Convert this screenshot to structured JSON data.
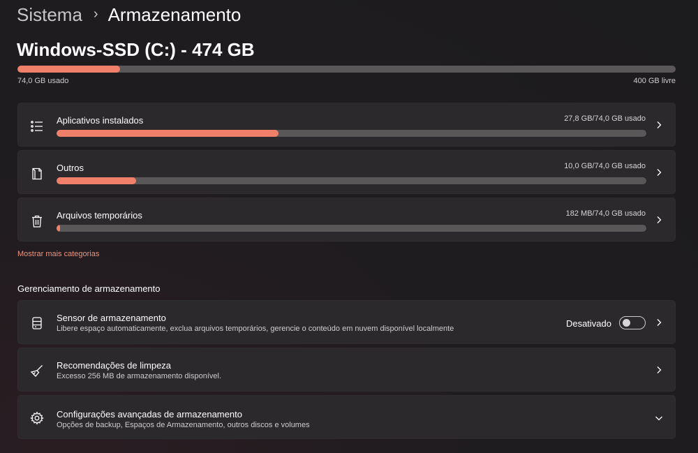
{
  "breadcrumb": {
    "parent": "Sistema",
    "separator": "›",
    "current": "Armazenamento"
  },
  "drive": {
    "title": "Windows-SSD (C:) - 474 GB",
    "used_label": "74,0 GB usado",
    "free_label": "400 GB livre",
    "used_fraction": 0.156
  },
  "categories": [
    {
      "label": "Aplicativos instalados",
      "value": "27,8 GB/74,0 GB usado",
      "fraction": 0.376,
      "icon": "list-icon"
    },
    {
      "label": "Outros",
      "value": "10,0 GB/74,0 GB usado",
      "fraction": 0.135,
      "icon": "document-icon"
    },
    {
      "label": "Arquivos temporários",
      "value": "182 MB/74,0 GB usado",
      "fraction": 0.0025,
      "icon": "trash-icon"
    }
  ],
  "more_categories_label": "Mostrar mais categorias",
  "management": {
    "title": "Gerenciamento de armazenamento",
    "items": [
      {
        "label": "Sensor de armazenamento",
        "sub": "Libere espaço automaticamente, exclua arquivos temporários, gerencie o conteúdo em nuvem disponível localmente",
        "toggle_label": "Desativado",
        "toggle_on": false,
        "icon": "storage-sense-icon"
      },
      {
        "label": "Recomendações de limpeza",
        "sub": "Excesso 256 MB de armazenamento disponível.",
        "icon": "broom-icon"
      },
      {
        "label": "Configurações avançadas de armazenamento",
        "sub": "Opções de backup, Espaços de Armazenamento, outros discos e volumes",
        "icon": "gear-icon"
      }
    ]
  },
  "colors": {
    "accent": "#f0806a",
    "link": "#f0937e",
    "track": "#5a5758",
    "card": "#2b292c"
  }
}
